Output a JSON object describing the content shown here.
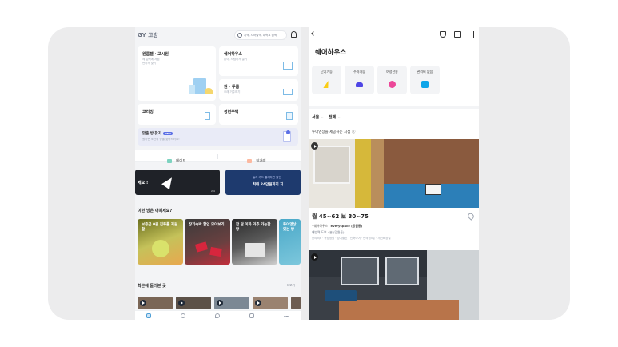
{
  "left_app": {
    "logo": "GY 고방",
    "search_placeholder": "지역, 지하철역, 대학교 검색",
    "cards": [
      {
        "title": "원룸텔 · 고시원",
        "sub1": "에 입력에 저렴",
        "sub2": "편하게 찾기"
      },
      {
        "title": "쉐어하우스",
        "sub1": "같이, 저렴하게 살기"
      },
      {
        "title": "원 · 투룸",
        "sub1": "오래 거주하기"
      },
      {
        "title": "코리빙"
      },
      {
        "title": "청년주택"
      }
    ],
    "banner": {
      "title": "맞춤 방 찾기",
      "badge": "NEW",
      "sub": "원하는 조건의 방을 찾아드려요!"
    },
    "tabs": [
      "메이트",
      "직거래"
    ],
    "promo_left": "세요 !",
    "promo_left_page": "2/4",
    "promo_right_line1": "둘리 카드 결제하면 할인",
    "promo_right_line2": "최대 24만원까지 지",
    "section_title": "이런 방은 어떠세요?",
    "recommend": [
      {
        "title": "보증금 0원 집투를 지원할"
      },
      {
        "title": "장기숙박 할인 모아보기"
      },
      {
        "title": "한 달 이하 거주 가능한 방"
      },
      {
        "title": "투어영상 있는 방"
      }
    ],
    "recent_title": "최근에 둘러본 곳",
    "recent_more": "더보기"
  },
  "right_app": {
    "page_title": "쉐어하우스",
    "features": [
      {
        "label": "단기거능",
        "icon": "lightning-icon",
        "color": "#facc15"
      },
      {
        "label": "주차거능",
        "icon": "car-icon",
        "color": "#4f46e5"
      },
      {
        "label": "여성전용",
        "icon": "female-icon",
        "color": "#ec4899"
      },
      {
        "label": "관리비 없음",
        "icon": "card-icon",
        "color": "#0ea5e9"
      }
    ],
    "filter_region": "서울",
    "filter_all": "전체",
    "section_label": "투어영상을 제공하는 지점",
    "listing": {
      "price": "월 45~62  보 30~75",
      "type": "쉐어하우스",
      "name": "everyspace (망원동)",
      "address": "내방역 도보 4분 (망원동)",
      "tags": "관리비X · 옥상정원 · 장기할인 · 신축이어 · 편의점5분 · 개인화장실"
    }
  }
}
